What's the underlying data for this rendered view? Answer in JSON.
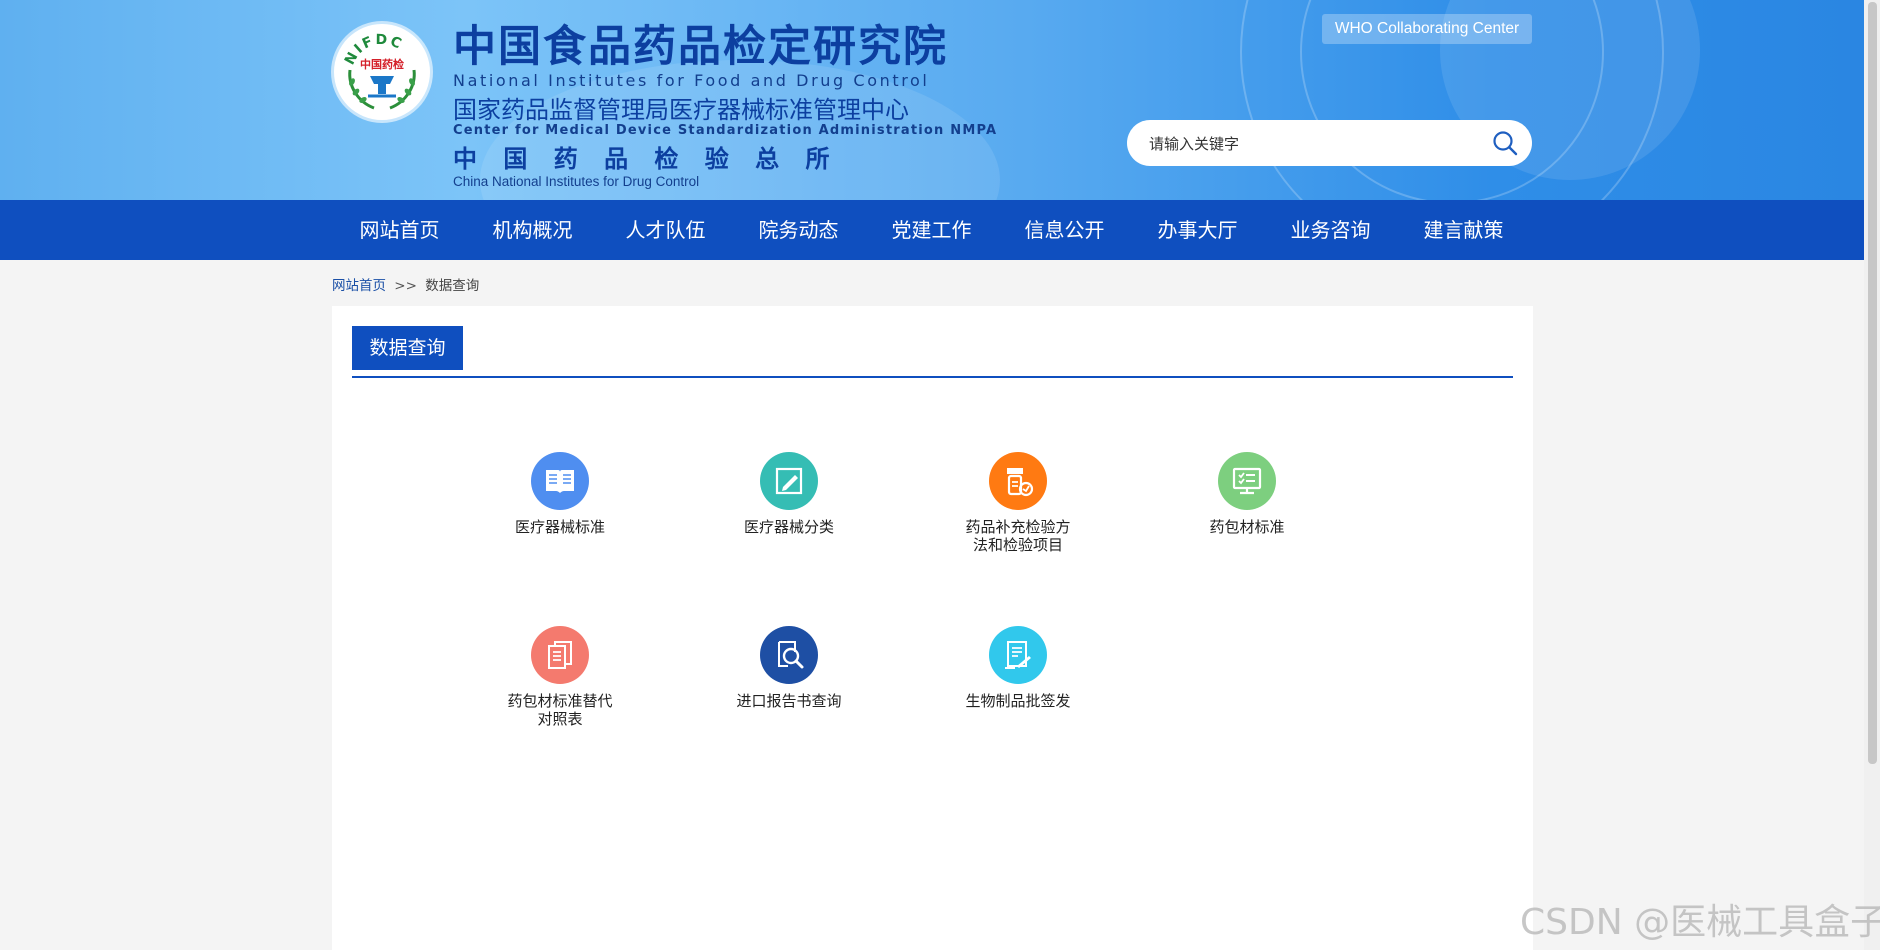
{
  "header": {
    "title_cn": "中国食品药品检定研究院",
    "title_en": "National Institutes for Food and Drug Control",
    "sub1_cn": "国家药品监督管理局医疗器械标准管理中心",
    "sub1_en": "Center for Medical Device Standardization Administration NMPA",
    "sub2_cn": "中 国 药 品 检 验 总 所",
    "sub2_en": "China National Institutes for Drug Control",
    "emblem_top": "NIFDC",
    "emblem_center": "中国药检",
    "who_label": "WHO Collaborating Center",
    "search_placeholder": "请输入关键字"
  },
  "nav": {
    "items": [
      "网站首页",
      "机构概况",
      "人才队伍",
      "院务动态",
      "党建工作",
      "信息公开",
      "办事大厅",
      "业务咨询",
      "建言献策"
    ]
  },
  "breadcrumb": {
    "home": "网站首页",
    "separator": ">>",
    "current": "数据查询"
  },
  "panel": {
    "title": "数据查询",
    "tiles": [
      {
        "label": "医疗器械标准",
        "icon": "book-icon",
        "color": "#4f8ef0"
      },
      {
        "label": "医疗器械分类",
        "icon": "pen-on-paper-icon",
        "color": "#35bdb4"
      },
      {
        "label": "药品补充检验方法和检验项目",
        "line1": "药品补充检验方",
        "line2": "法和检验项目",
        "icon": "medicine-bottle-icon",
        "color": "#ff7a12"
      },
      {
        "label": "药包材标准",
        "icon": "monitor-checklist-icon",
        "color": "#7dcf7f"
      },
      {
        "label": "药包材标准替代对照表",
        "line1": "药包材标准替代",
        "line2": "对照表",
        "icon": "documents-icon",
        "color": "#f47a6e"
      },
      {
        "label": "进口报告书查询",
        "icon": "magnifier-document-icon",
        "color": "#1e4fa4"
      },
      {
        "label": "生物制品批签发",
        "icon": "signed-document-icon",
        "color": "#31c8ec"
      }
    ]
  },
  "watermark": "CSDN @医械工具盒子"
}
